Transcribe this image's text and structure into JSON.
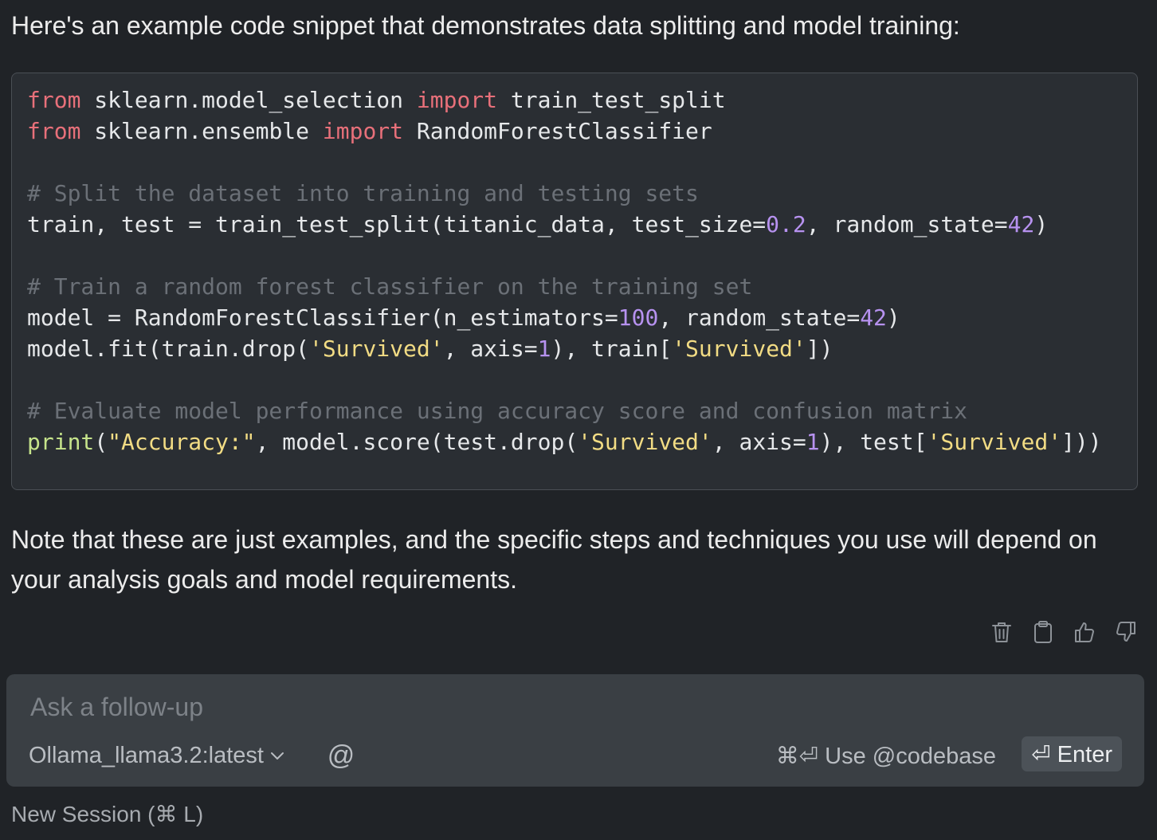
{
  "message": {
    "intro": "Here's an example code snippet that demonstrates data splitting and model training:",
    "code_lines": [
      [
        {
          "t": "kw",
          "v": "from"
        },
        {
          "t": "txt",
          "v": " sklearn.model_selection "
        },
        {
          "t": "kw",
          "v": "import"
        },
        {
          "t": "txt",
          "v": " train_test_split"
        }
      ],
      [
        {
          "t": "kw",
          "v": "from"
        },
        {
          "t": "txt",
          "v": " sklearn.ensemble "
        },
        {
          "t": "kw",
          "v": "import"
        },
        {
          "t": "txt",
          "v": " RandomForestClassifier"
        }
      ],
      [],
      [
        {
          "t": "cm",
          "v": "# Split the dataset into training and testing sets"
        }
      ],
      [
        {
          "t": "txt",
          "v": "train, test = train_test_split(titanic_data, test_size="
        },
        {
          "t": "num",
          "v": "0.2"
        },
        {
          "t": "txt",
          "v": ", random_state="
        },
        {
          "t": "num",
          "v": "42"
        },
        {
          "t": "txt",
          "v": ")"
        }
      ],
      [],
      [
        {
          "t": "cm",
          "v": "# Train a random forest classifier on the training set"
        }
      ],
      [
        {
          "t": "txt",
          "v": "model = RandomForestClassifier(n_estimators="
        },
        {
          "t": "num",
          "v": "100"
        },
        {
          "t": "txt",
          "v": ", random_state="
        },
        {
          "t": "num",
          "v": "42"
        },
        {
          "t": "txt",
          "v": ")"
        }
      ],
      [
        {
          "t": "txt",
          "v": "model.fit(train.drop("
        },
        {
          "t": "str",
          "v": "'Survived'"
        },
        {
          "t": "txt",
          "v": ", axis="
        },
        {
          "t": "num",
          "v": "1"
        },
        {
          "t": "txt",
          "v": "), train["
        },
        {
          "t": "str",
          "v": "'Survived'"
        },
        {
          "t": "txt",
          "v": "])"
        }
      ],
      [],
      [
        {
          "t": "cm",
          "v": "# Evaluate model performance using accuracy score and confusion matrix"
        }
      ],
      [
        {
          "t": "fn",
          "v": "print"
        },
        {
          "t": "txt",
          "v": "("
        },
        {
          "t": "str",
          "v": "\"Accuracy:\""
        },
        {
          "t": "txt",
          "v": ", model.score(test.drop("
        },
        {
          "t": "str",
          "v": "'Survived'"
        },
        {
          "t": "txt",
          "v": ", axis="
        },
        {
          "t": "num",
          "v": "1"
        },
        {
          "t": "txt",
          "v": "), test["
        },
        {
          "t": "str",
          "v": "'Survived'"
        },
        {
          "t": "txt",
          "v": "]))"
        }
      ]
    ],
    "note": "Note that these are just examples, and the specific steps and techniques you use will depend on your analysis goals and model requirements."
  },
  "actions": {
    "icons": [
      "trash-icon",
      "clipboard-icon",
      "thumbs-up-icon",
      "thumbs-down-icon"
    ]
  },
  "input": {
    "placeholder": "Ask a follow-up",
    "model_label": "Ollama_llama3.2:latest",
    "at_label": "@",
    "codebase_hint": "⌘⏎ Use @codebase",
    "enter_label": "⏎ Enter"
  },
  "footer": {
    "new_session": "New Session (⌘ L)"
  },
  "colors": {
    "background": "#202327",
    "code_background": "#2a2e33",
    "keyword": "#e8707a",
    "comment": "#6b7077",
    "number": "#b792f0",
    "string": "#f2dc84",
    "function": "#c6e48b"
  }
}
